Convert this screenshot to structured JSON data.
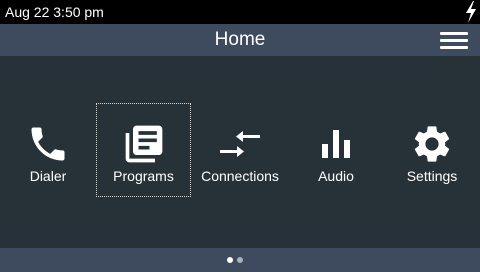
{
  "status_bar": {
    "time": "Aug 22 3:50 pm",
    "power_icon": "lightning-bolt-icon"
  },
  "header": {
    "title": "Home",
    "menu_icon": "hamburger-menu-icon"
  },
  "apps": [
    {
      "label": "Dialer",
      "icon": "phone-icon",
      "focused": false
    },
    {
      "label": "Programs",
      "icon": "programs-library-icon",
      "focused": true
    },
    {
      "label": "Connections",
      "icon": "connections-arrows-icon",
      "focused": false
    },
    {
      "label": "Audio",
      "icon": "audio-levels-icon",
      "focused": false
    },
    {
      "label": "Settings",
      "icon": "gear-icon",
      "focused": false
    }
  ],
  "pagination": {
    "total_pages": 2,
    "current_page": 1
  },
  "colors": {
    "status_bar_bg": "#000000",
    "header_bg": "#3e4b5e",
    "body_bg": "#273238",
    "active_dot": "#ffffff",
    "inactive_dot": "#a9b1bc"
  }
}
